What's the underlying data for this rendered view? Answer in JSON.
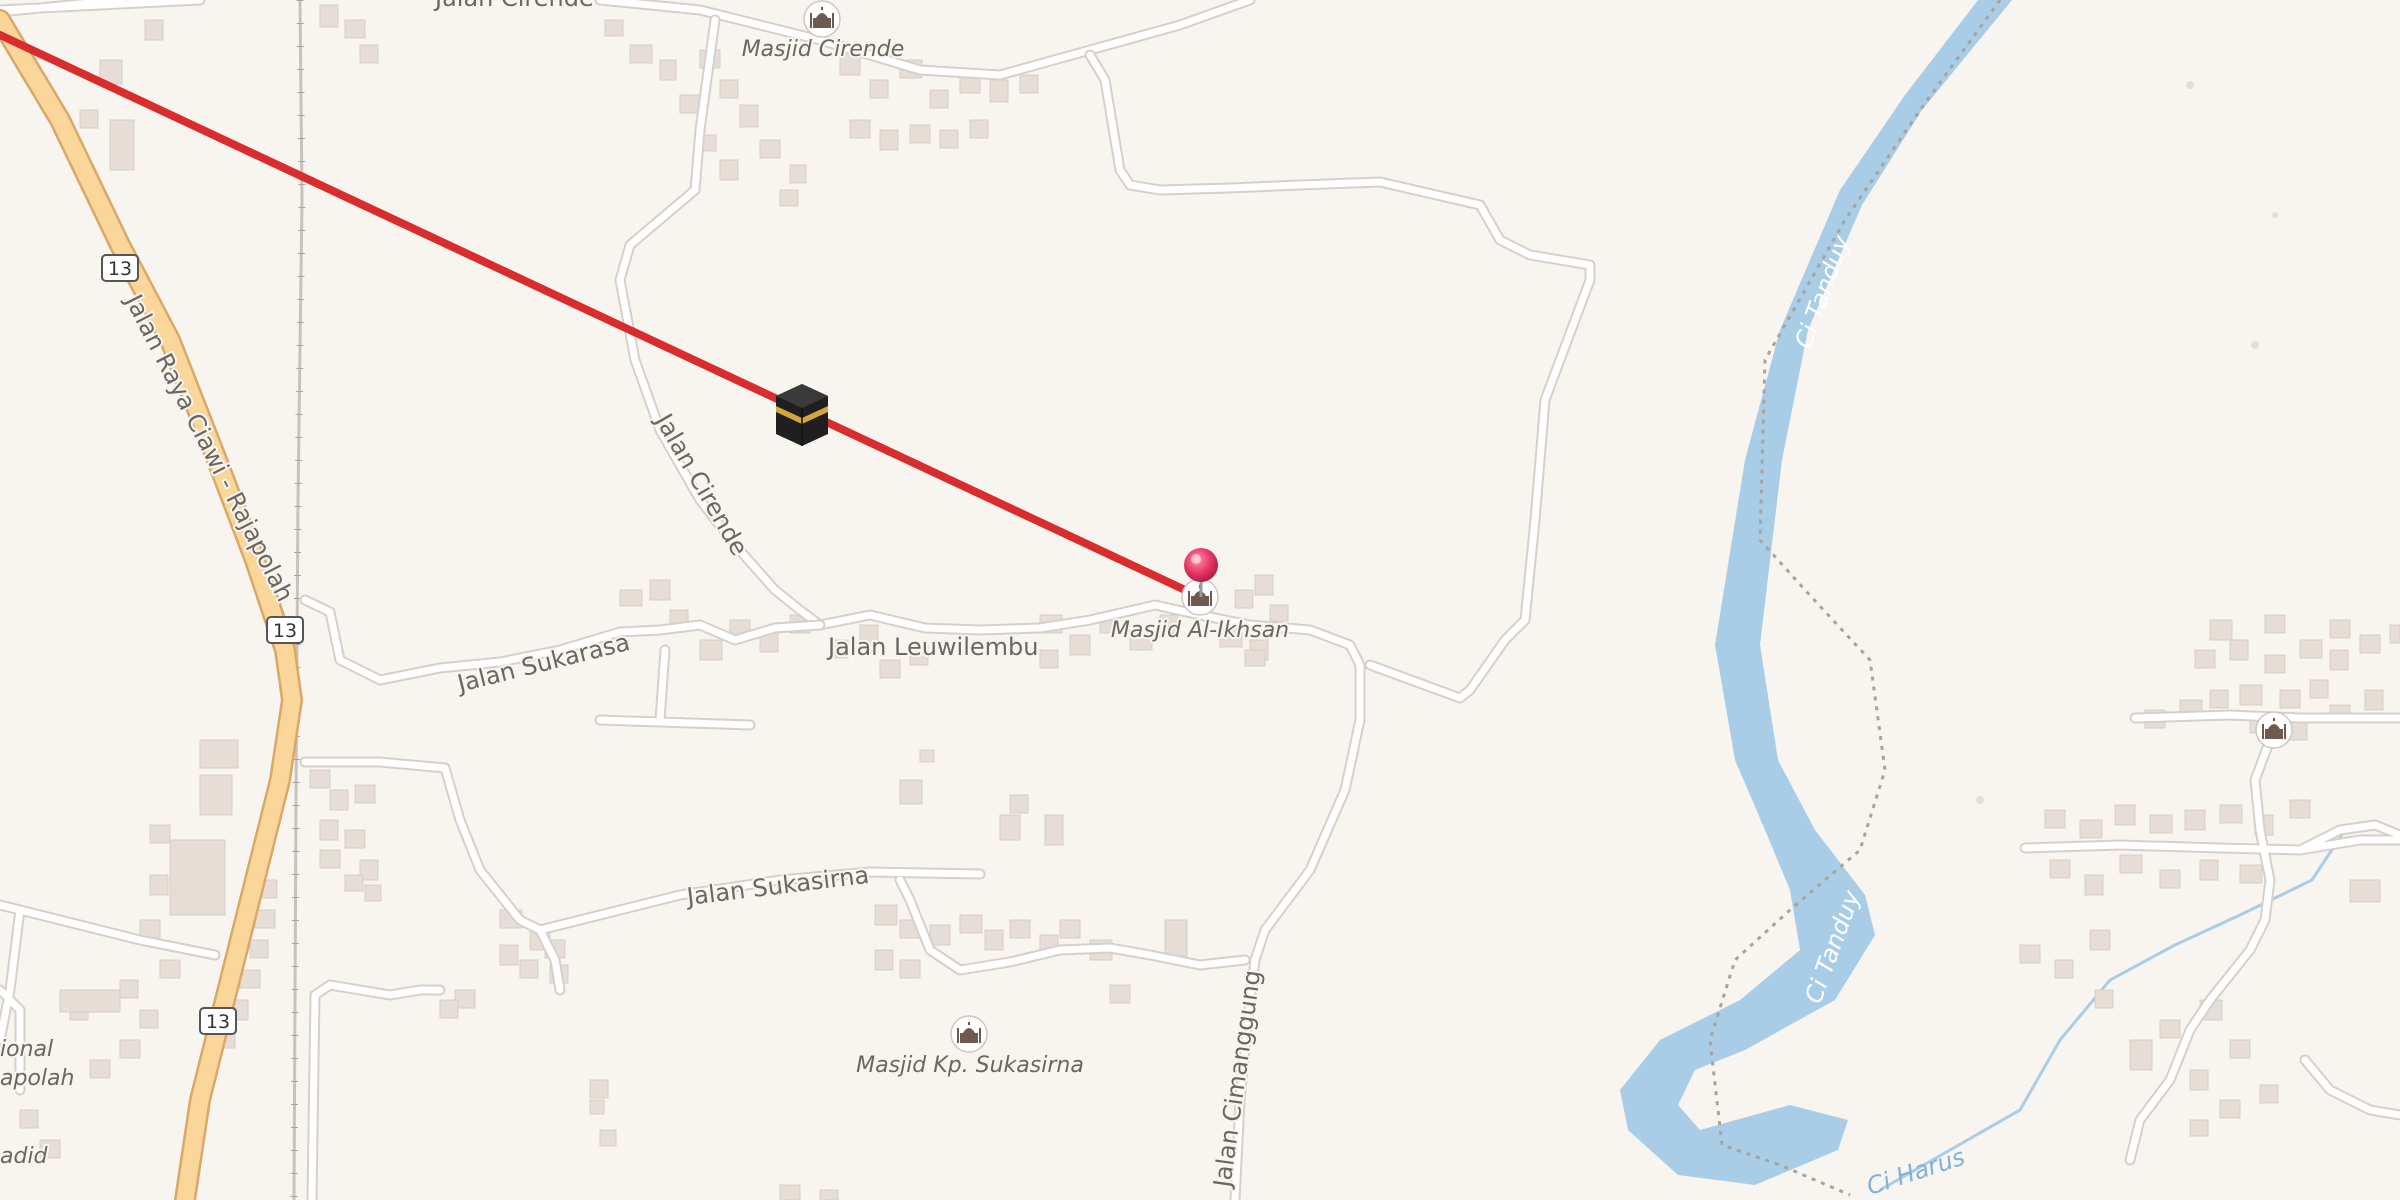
{
  "map": {
    "colors": {
      "land": "#f8f5f1",
      "water": "#a9cde6",
      "primary_road": "#fbd69b",
      "route_line": "#d92d2d",
      "pin": "#e83563"
    },
    "roads": {
      "jalan_raya": "Jalan Raya Ciawi - Rajapolah",
      "jalan_cirende_top": "Jalan Cirende",
      "jalan_cirende": "Jalan Cirende",
      "jalan_leuwilembu": "Jalan Leuwilembu",
      "jalan_sukarasa": "Jalan Sukarasa",
      "jalan_sukasirna": "Jalan Sukasirna",
      "jalan_cimanggung": "Jalan Cimanggung"
    },
    "shields": [
      "13",
      "13",
      "13"
    ],
    "pois": {
      "masjid_cirende": "Masjid Cirende",
      "masjid_al_ikhsan": "Masjid Al-Ikhsan",
      "masjid_kp_sukasirna": "Masjid Kp. Sukasirna"
    },
    "rivers": {
      "ci_tanduy_top": "Ci Tanduy",
      "ci_tanduy_bottom": "Ci Tanduy",
      "ci_harus": "Ci Harus"
    },
    "partial_labels": {
      "left1": "ional",
      "left2": "apolah",
      "left3": "adid"
    },
    "markers": {
      "kaaba": "kaaba-icon",
      "pin": "location-pin-icon",
      "mosque": "mosque-icon"
    }
  }
}
